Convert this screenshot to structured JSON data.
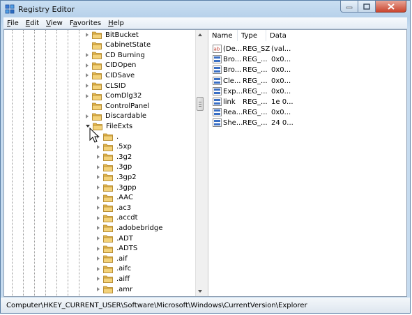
{
  "window": {
    "title": "Registry Editor"
  },
  "menu": [
    {
      "accel": "F",
      "rest": "ile"
    },
    {
      "accel": "E",
      "rest": "dit"
    },
    {
      "accel": "V",
      "rest": "iew"
    },
    {
      "pre": "F",
      "accel": "a",
      "rest": "vorites"
    },
    {
      "accel": "H",
      "rest": "elp"
    }
  ],
  "tree": {
    "level1_items": [
      "BitBucket",
      "CabinetState",
      "CD Burning",
      "CIDOpen",
      "CIDSave",
      "CLSID",
      "ComDlg32",
      "ControlPanel",
      "Discardable",
      "FileExts"
    ],
    "level2_items": [
      ".",
      ".5xp",
      ".3g2",
      ".3gp",
      ".3gp2",
      ".3gpp",
      ".AAC",
      ".ac3",
      ".accdt",
      ".adobebridge",
      ".ADT",
      ".ADTS",
      ".aif",
      ".aifc",
      ".aiff",
      ".amr"
    ]
  },
  "list": {
    "columns": [
      "Name",
      "Type",
      "Data"
    ],
    "rows": [
      {
        "name": "(De...",
        "type": "REG_SZ",
        "data": "(val...",
        "icon": "string-value-icon"
      },
      {
        "name": "Bro...",
        "type": "REG_...",
        "data": "0x0...",
        "icon": "binary-value-icon"
      },
      {
        "name": "Bro...",
        "type": "REG_...",
        "data": "0x0...",
        "icon": "binary-value-icon"
      },
      {
        "name": "Cle...",
        "type": "REG_...",
        "data": "0x0...",
        "icon": "binary-value-icon"
      },
      {
        "name": "Exp...",
        "type": "REG_...",
        "data": "0x0...",
        "icon": "binary-value-icon"
      },
      {
        "name": "link",
        "type": "REG_...",
        "data": "1e 0...",
        "icon": "binary-value-icon"
      },
      {
        "name": "Rea...",
        "type": "REG_...",
        "data": "0x0...",
        "icon": "binary-value-icon"
      },
      {
        "name": "She...",
        "type": "REG_...",
        "data": "24 0...",
        "icon": "binary-value-icon"
      }
    ]
  },
  "status": {
    "path": "Computer\\HKEY_CURRENT_USER\\Software\\Microsoft\\Windows\\CurrentVersion\\Explorer"
  }
}
